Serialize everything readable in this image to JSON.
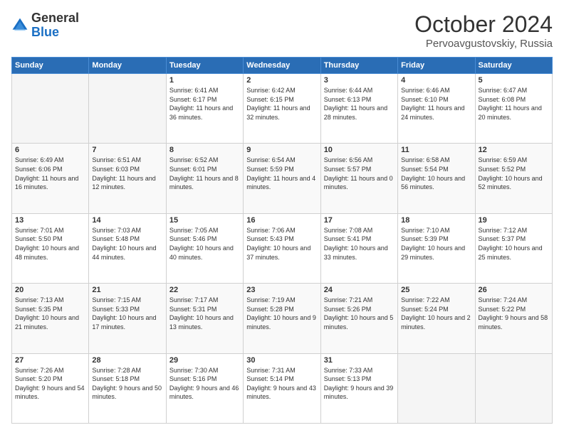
{
  "header": {
    "logo_general": "General",
    "logo_blue": "Blue",
    "month": "October 2024",
    "location": "Pervoavgustovskiy, Russia"
  },
  "days_of_week": [
    "Sunday",
    "Monday",
    "Tuesday",
    "Wednesday",
    "Thursday",
    "Friday",
    "Saturday"
  ],
  "weeks": [
    [
      {
        "num": "",
        "info": ""
      },
      {
        "num": "",
        "info": ""
      },
      {
        "num": "1",
        "info": "Sunrise: 6:41 AM\nSunset: 6:17 PM\nDaylight: 11 hours\nand 36 minutes."
      },
      {
        "num": "2",
        "info": "Sunrise: 6:42 AM\nSunset: 6:15 PM\nDaylight: 11 hours\nand 32 minutes."
      },
      {
        "num": "3",
        "info": "Sunrise: 6:44 AM\nSunset: 6:13 PM\nDaylight: 11 hours\nand 28 minutes."
      },
      {
        "num": "4",
        "info": "Sunrise: 6:46 AM\nSunset: 6:10 PM\nDaylight: 11 hours\nand 24 minutes."
      },
      {
        "num": "5",
        "info": "Sunrise: 6:47 AM\nSunset: 6:08 PM\nDaylight: 11 hours\nand 20 minutes."
      }
    ],
    [
      {
        "num": "6",
        "info": "Sunrise: 6:49 AM\nSunset: 6:06 PM\nDaylight: 11 hours\nand 16 minutes."
      },
      {
        "num": "7",
        "info": "Sunrise: 6:51 AM\nSunset: 6:03 PM\nDaylight: 11 hours\nand 12 minutes."
      },
      {
        "num": "8",
        "info": "Sunrise: 6:52 AM\nSunset: 6:01 PM\nDaylight: 11 hours\nand 8 minutes."
      },
      {
        "num": "9",
        "info": "Sunrise: 6:54 AM\nSunset: 5:59 PM\nDaylight: 11 hours\nand 4 minutes."
      },
      {
        "num": "10",
        "info": "Sunrise: 6:56 AM\nSunset: 5:57 PM\nDaylight: 11 hours\nand 0 minutes."
      },
      {
        "num": "11",
        "info": "Sunrise: 6:58 AM\nSunset: 5:54 PM\nDaylight: 10 hours\nand 56 minutes."
      },
      {
        "num": "12",
        "info": "Sunrise: 6:59 AM\nSunset: 5:52 PM\nDaylight: 10 hours\nand 52 minutes."
      }
    ],
    [
      {
        "num": "13",
        "info": "Sunrise: 7:01 AM\nSunset: 5:50 PM\nDaylight: 10 hours\nand 48 minutes."
      },
      {
        "num": "14",
        "info": "Sunrise: 7:03 AM\nSunset: 5:48 PM\nDaylight: 10 hours\nand 44 minutes."
      },
      {
        "num": "15",
        "info": "Sunrise: 7:05 AM\nSunset: 5:46 PM\nDaylight: 10 hours\nand 40 minutes."
      },
      {
        "num": "16",
        "info": "Sunrise: 7:06 AM\nSunset: 5:43 PM\nDaylight: 10 hours\nand 37 minutes."
      },
      {
        "num": "17",
        "info": "Sunrise: 7:08 AM\nSunset: 5:41 PM\nDaylight: 10 hours\nand 33 minutes."
      },
      {
        "num": "18",
        "info": "Sunrise: 7:10 AM\nSunset: 5:39 PM\nDaylight: 10 hours\nand 29 minutes."
      },
      {
        "num": "19",
        "info": "Sunrise: 7:12 AM\nSunset: 5:37 PM\nDaylight: 10 hours\nand 25 minutes."
      }
    ],
    [
      {
        "num": "20",
        "info": "Sunrise: 7:13 AM\nSunset: 5:35 PM\nDaylight: 10 hours\nand 21 minutes."
      },
      {
        "num": "21",
        "info": "Sunrise: 7:15 AM\nSunset: 5:33 PM\nDaylight: 10 hours\nand 17 minutes."
      },
      {
        "num": "22",
        "info": "Sunrise: 7:17 AM\nSunset: 5:31 PM\nDaylight: 10 hours\nand 13 minutes."
      },
      {
        "num": "23",
        "info": "Sunrise: 7:19 AM\nSunset: 5:28 PM\nDaylight: 10 hours\nand 9 minutes."
      },
      {
        "num": "24",
        "info": "Sunrise: 7:21 AM\nSunset: 5:26 PM\nDaylight: 10 hours\nand 5 minutes."
      },
      {
        "num": "25",
        "info": "Sunrise: 7:22 AM\nSunset: 5:24 PM\nDaylight: 10 hours\nand 2 minutes."
      },
      {
        "num": "26",
        "info": "Sunrise: 7:24 AM\nSunset: 5:22 PM\nDaylight: 9 hours\nand 58 minutes."
      }
    ],
    [
      {
        "num": "27",
        "info": "Sunrise: 7:26 AM\nSunset: 5:20 PM\nDaylight: 9 hours\nand 54 minutes."
      },
      {
        "num": "28",
        "info": "Sunrise: 7:28 AM\nSunset: 5:18 PM\nDaylight: 9 hours\nand 50 minutes."
      },
      {
        "num": "29",
        "info": "Sunrise: 7:30 AM\nSunset: 5:16 PM\nDaylight: 9 hours\nand 46 minutes."
      },
      {
        "num": "30",
        "info": "Sunrise: 7:31 AM\nSunset: 5:14 PM\nDaylight: 9 hours\nand 43 minutes."
      },
      {
        "num": "31",
        "info": "Sunrise: 7:33 AM\nSunset: 5:13 PM\nDaylight: 9 hours\nand 39 minutes."
      },
      {
        "num": "",
        "info": ""
      },
      {
        "num": "",
        "info": ""
      }
    ]
  ]
}
